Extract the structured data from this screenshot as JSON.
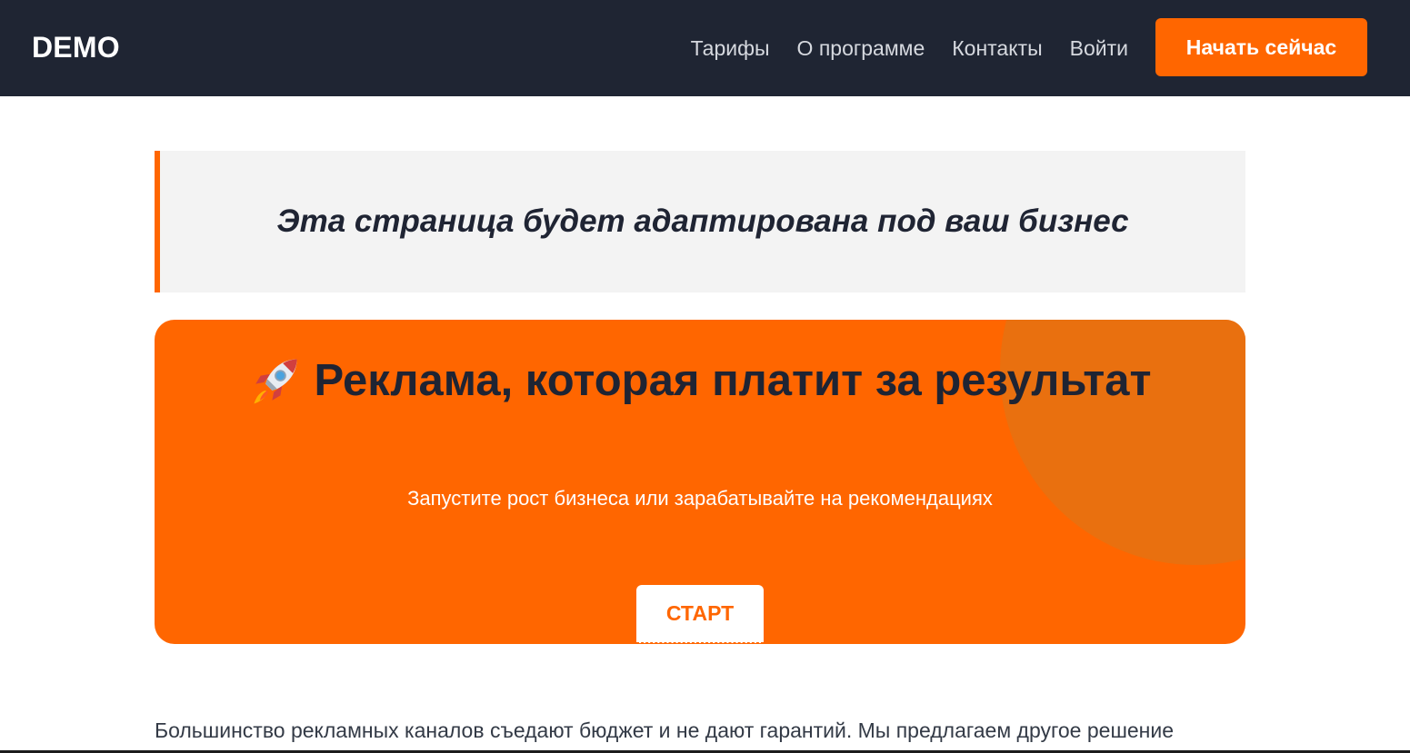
{
  "header": {
    "logo": "DEMO",
    "nav": [
      {
        "label": "Тарифы"
      },
      {
        "label": "О программе"
      },
      {
        "label": "Контакты"
      },
      {
        "label": "Войти"
      }
    ],
    "cta_label": "Начать сейчас"
  },
  "notice": {
    "text": "Эта страница будет адаптирована под ваш бизнес"
  },
  "hero": {
    "icon": "rocket-icon",
    "title": "Реклама, которая платит за результат",
    "subtitle": "Запустите рост бизнеса или зарабатывайте на рекомендациях",
    "button_label": "СТАРТ"
  },
  "intro": {
    "text": "Большинство рекламных каналов съедают бюджет и не дают гарантий. Мы предлагаем другое решение"
  },
  "colors": {
    "accent": "#ff6600",
    "navbar": "#1f2533",
    "text_dark": "#1f2433",
    "notice_bg": "#f3f3f3"
  }
}
